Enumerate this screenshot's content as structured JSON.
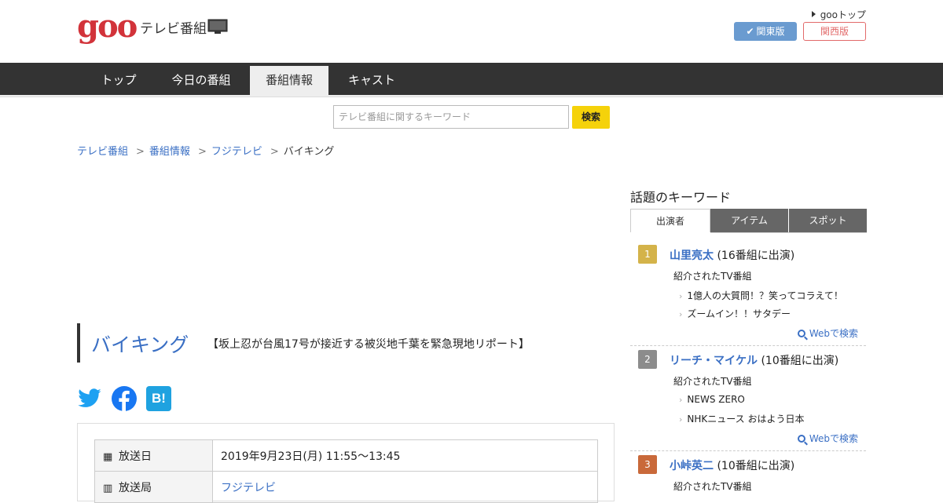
{
  "header": {
    "logo": "goo",
    "site_name": "テレビ番組",
    "goo_top": "gooトップ",
    "kanto_label": "関東版",
    "kansai_label": "関西版"
  },
  "nav": {
    "items": [
      {
        "label": "トップ"
      },
      {
        "label": "今日の番組"
      },
      {
        "label": "番組情報"
      },
      {
        "label": "キャスト"
      }
    ],
    "active": "番組情報"
  },
  "search": {
    "placeholder": "テレビ番組に関するキーワード",
    "button": "検索"
  },
  "breadcrumb": [
    "テレビ番組",
    "番組情報",
    "フジテレビ",
    "バイキング"
  ],
  "program": {
    "title": "バイキング",
    "subtitle": "【坂上忍が台風17号が接近する被災地千葉を緊急現地リポート】"
  },
  "social": [
    "twitter-icon",
    "facebook-icon",
    "hatena-bookmark-icon"
  ],
  "social_labels": {
    "hatena": "B!"
  },
  "info": {
    "rows": [
      {
        "label": "放送日",
        "value": "2019年9月23日(月) 11:55～13:45",
        "icon": "calendar-icon"
      },
      {
        "label": "放送局",
        "value": "フジテレビ",
        "icon": "building-icon"
      }
    ]
  },
  "sidebar": {
    "title": "話題のキーワード",
    "tabs": [
      "出演者",
      "アイテム",
      "スポット"
    ],
    "active_tab": "出演者",
    "intro_label": "紹介されたTV番組",
    "web_search_label": "Webで検索",
    "ranking": [
      {
        "rank": "1",
        "name": "山里亮太",
        "count": "(16番組に出演)",
        "color": "#d4b34a",
        "programs": [
          "1億人の大質問！？笑ってコラえて！",
          "ズームイン！！サタデー"
        ]
      },
      {
        "rank": "2",
        "name": "リーチ・マイケル",
        "count": "(10番組に出演)",
        "color": "#8c8c8c",
        "programs": [
          "NEWS ZERO",
          "NHKニュース おはよう日本"
        ]
      },
      {
        "rank": "3",
        "name": "小峠英二",
        "count": "(10番組に出演)",
        "color": "#c9693a",
        "programs": []
      }
    ]
  },
  "colors": {
    "brand": "#d2333a",
    "link": "#3a6fc4",
    "nav_bg": "#333333",
    "search_button": "#f5d20a"
  }
}
